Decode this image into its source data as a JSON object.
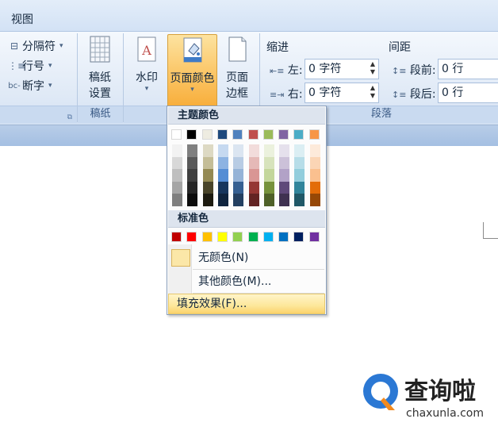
{
  "tabs": {
    "view": "视图"
  },
  "ribbon": {
    "manuscript_group": {
      "items": [
        {
          "label": "分隔符",
          "icon": "breaks-icon"
        },
        {
          "label": "行号",
          "icon": "line-numbers-icon"
        },
        {
          "label": "断字",
          "icon": "hyphenation-icon"
        }
      ]
    },
    "gaozhi_group": {
      "button_line1": "稿纸",
      "button_line2": "设置",
      "group_label": "稿纸"
    },
    "page_bg": {
      "watermark": "水印",
      "page_color_line1": "页面颜色",
      "page_borders_line1": "页面",
      "page_borders_line2": "边框"
    },
    "paragraph_group": {
      "indent_title": "缩进",
      "spacing_title": "间距",
      "indent_left_label": "左:",
      "indent_left_value": "0 字符",
      "indent_right_label": "右:",
      "indent_right_value": "0 字符",
      "spacing_before_label": "段前:",
      "spacing_before_value": "0 行",
      "spacing_after_label": "段后:",
      "spacing_after_value": "0 行",
      "group_label": "段落"
    }
  },
  "dropdown": {
    "theme_colors_header": "主题颜色",
    "standard_colors_header": "标准色",
    "no_color": "无颜色(N)",
    "more_colors": "其他颜色(M)...",
    "fill_effects": "填充效果(F)...",
    "theme_top_row": [
      "#ffffff",
      "#000000",
      "#eeece1",
      "#1f497d",
      "#4f81bd",
      "#c0504d",
      "#9bbb59",
      "#8064a2",
      "#4bacc6",
      "#f79646"
    ],
    "theme_shades": [
      [
        "#f2f2f2",
        "#d8d8d8",
        "#bfbfbf",
        "#a5a5a5",
        "#7f7f7f"
      ],
      [
        "#7f7f7f",
        "#595959",
        "#3f3f3f",
        "#262626",
        "#0c0c0c"
      ],
      [
        "#ddd9c3",
        "#c4bd97",
        "#938953",
        "#494429",
        "#1d1b10"
      ],
      [
        "#c6d9f0",
        "#8db3e2",
        "#548dd4",
        "#17365d",
        "#0f243e"
      ],
      [
        "#dbe5f1",
        "#b8cce4",
        "#95b3d7",
        "#366092",
        "#244061"
      ],
      [
        "#f2dcdb",
        "#e5b9b7",
        "#d99694",
        "#953734",
        "#632423"
      ],
      [
        "#ebf1dd",
        "#d7e3bc",
        "#c3d69b",
        "#76923c",
        "#4f6128"
      ],
      [
        "#e5e0ec",
        "#ccc1d9",
        "#b2a2c7",
        "#5f497a",
        "#3f3151"
      ],
      [
        "#dbeef3",
        "#b7dde8",
        "#92cddc",
        "#31859b",
        "#205867"
      ],
      [
        "#fdeada",
        "#fbd5b5",
        "#fac08f",
        "#e36c09",
        "#974806"
      ]
    ],
    "standard_colors": [
      "#c00000",
      "#ff0000",
      "#ffc000",
      "#ffff00",
      "#92d050",
      "#00b050",
      "#00b0f0",
      "#0070c0",
      "#002060",
      "#7030a0"
    ]
  },
  "watermark_logo": {
    "text": "查询啦",
    "url": "chaxunla.com"
  }
}
